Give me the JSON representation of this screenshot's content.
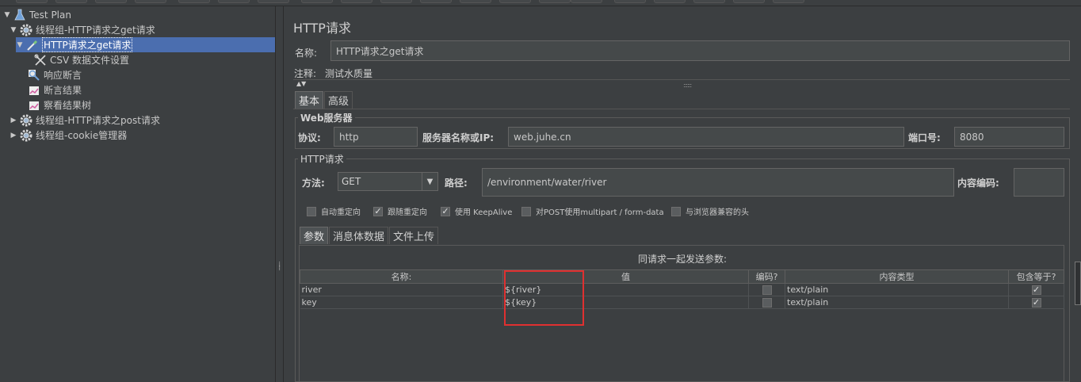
{
  "tree": {
    "items": [
      {
        "label": "Test Plan",
        "arrow": "▼",
        "icon": "flask-icon"
      },
      {
        "label": "线程组-HTTP请求之get请求",
        "arrow": "▼",
        "icon": "gear-icon"
      },
      {
        "label": "HTTP请求之get请求",
        "arrow": "▼",
        "icon": "pipette-icon"
      },
      {
        "label": "CSV 数据文件设置",
        "arrow": "",
        "icon": "wrench-icon"
      },
      {
        "label": "响应断言",
        "arrow": "",
        "icon": "magnifier-icon"
      },
      {
        "label": "断言结果",
        "arrow": "",
        "icon": "chart-icon"
      },
      {
        "label": "察看结果树",
        "arrow": "",
        "icon": "chart-icon"
      },
      {
        "label": "线程组-HTTP请求之post请求",
        "arrow": "▶",
        "icon": "gear-icon"
      },
      {
        "label": "线程组-cookie管理器",
        "arrow": "▶",
        "icon": "gear-icon"
      }
    ],
    "selected_index": 2
  },
  "main": {
    "title": "HTTP请求",
    "name_label": "名称:",
    "name_value": "HTTP请求之get请求",
    "comment_label": "注释:",
    "comment_value": "测试水质量",
    "tabs": [
      {
        "label": "基本"
      },
      {
        "label": "高级"
      }
    ],
    "web_server": {
      "title": "Web服务器",
      "protocol_label": "协议:",
      "protocol_value": "http",
      "server_label": "服务器名称或IP:",
      "server_value": "web.juhe.cn",
      "port_label": "端口号:",
      "port_value": "8080"
    },
    "http_request": {
      "title": "HTTP请求",
      "method_label": "方法:",
      "method_value": "GET",
      "path_label": "路径:",
      "path_value": "/environment/water/river",
      "encoding_label": "内容编码:",
      "encoding_value": ""
    },
    "options": [
      {
        "label": "自动重定向",
        "checked": false
      },
      {
        "label": "跟随重定向",
        "checked": true
      },
      {
        "label": "使用 KeepAlive",
        "checked": true
      },
      {
        "label": "对POST使用multipart / form-data",
        "checked": false
      },
      {
        "label": "与浏览器兼容的头",
        "checked": false
      }
    ],
    "subtabs": [
      {
        "label": "参数"
      },
      {
        "label": "消息体数据"
      },
      {
        "label": "文件上传"
      }
    ],
    "params": {
      "caption": "同请求一起发送参数:",
      "columns": [
        "名称:",
        "值",
        "编码?",
        "内容类型",
        "包含等于?"
      ],
      "rows": [
        {
          "name": "river",
          "value": "${river}",
          "encode": false,
          "content_type": "text/plain",
          "include_equals": true
        },
        {
          "name": "key",
          "value": "${key}",
          "encode": false,
          "content_type": "text/plain",
          "include_equals": true
        }
      ]
    }
  }
}
